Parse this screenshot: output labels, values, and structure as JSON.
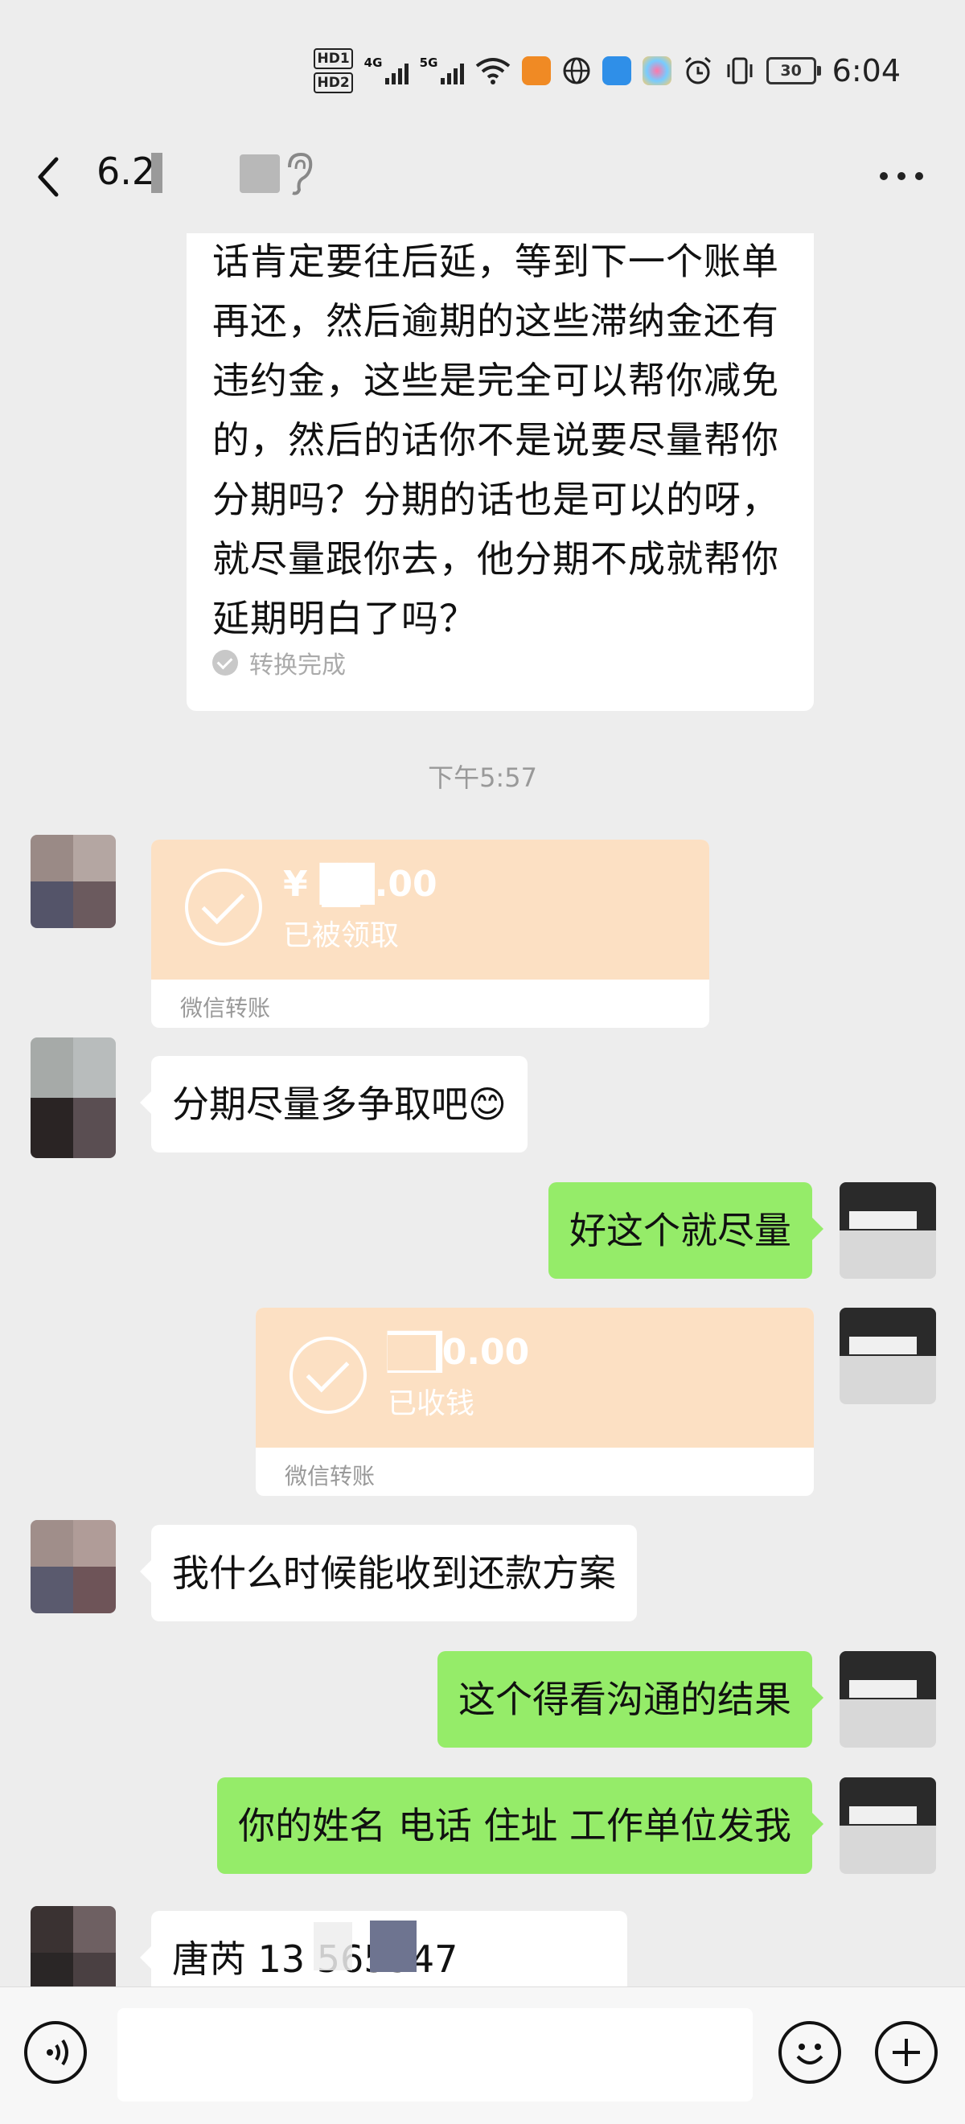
{
  "status_bar": {
    "hd_labels": [
      "HD1",
      "HD2"
    ],
    "sim1_label": "4G",
    "sim2_label": "5G",
    "battery": "30",
    "time": "6:04"
  },
  "nav": {
    "title": "6.2"
  },
  "messages": {
    "voice_transcript": "话肯定要往后延，等到下一个账单再还，然后逾期的这些滞纳金还有违约金，这些是完全可以帮你减免的，然后的话你不是说要尽量帮你分期吗？分期的话也是可以的呀，就尽量跟你去，他分期不成就帮你延期明白了吗？",
    "voice_status": "转换完成",
    "timestamp": "下午5:57",
    "transfer1": {
      "amount": "¥ ██.00",
      "status": "已被领取",
      "label": "微信转账"
    },
    "msg_in_1": "分期尽量多争取吧😊",
    "msg_out_1": "好这个就尽量",
    "transfer2": {
      "amount": "██0.00",
      "status": "已收钱",
      "label": "微信转账"
    },
    "msg_in_2": "我什么时候能收到还款方案",
    "msg_out_2": "这个得看沟通的结果",
    "msg_out_3": "你的姓名 电话 住址 工作单位发我",
    "msg_in_3": "唐芮 13 565547"
  },
  "colors": {
    "background": "#ededed",
    "outgoing_bubble": "#95ec69",
    "incoming_bubble": "#ffffff",
    "transfer_card": "#fce0c3"
  }
}
